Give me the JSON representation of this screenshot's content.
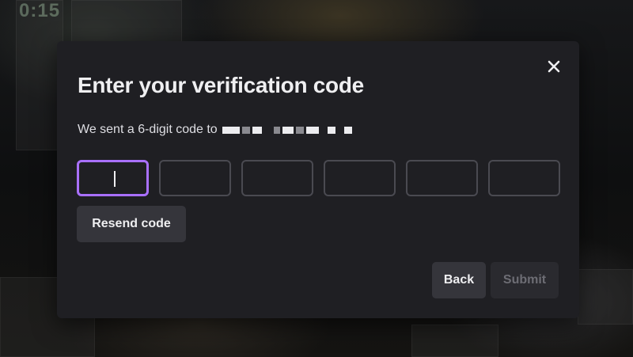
{
  "background": {
    "clock_text": "0:15"
  },
  "dialog": {
    "title": "Enter your verification code",
    "subtitle": "We sent a 6-digit code to",
    "code_digits": [
      "",
      "",
      "",
      "",
      "",
      ""
    ],
    "active_digit_index": 0,
    "resend_label": "Resend code",
    "back_label": "Back",
    "submit_label": "Submit",
    "close_icon": "close-icon"
  },
  "colors": {
    "accent": "#a970ff",
    "dialog_bg": "#1f1f23",
    "button_bg": "#35353b",
    "text": "#efeff1",
    "disabled_text": "#6d6d74"
  }
}
